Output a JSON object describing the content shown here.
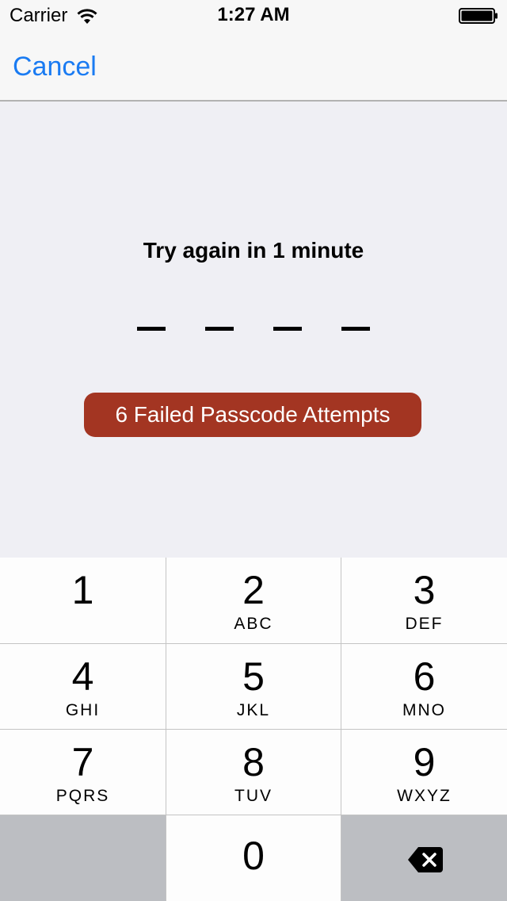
{
  "status_bar": {
    "carrier": "Carrier",
    "time": "1:27 AM",
    "wifi_icon": "wifi-icon",
    "battery_icon": "battery-icon"
  },
  "nav": {
    "cancel_label": "Cancel"
  },
  "lockout": {
    "prompt": "Try again in 1 minute",
    "passcode_length": 4,
    "failed_attempts_label": "6 Failed Passcode Attempts",
    "failed_badge_color": "#a33522"
  },
  "keypad": {
    "keys": [
      {
        "digit": "1",
        "letters": ""
      },
      {
        "digit": "2",
        "letters": "ABC"
      },
      {
        "digit": "3",
        "letters": "DEF"
      },
      {
        "digit": "4",
        "letters": "GHI"
      },
      {
        "digit": "5",
        "letters": "JKL"
      },
      {
        "digit": "6",
        "letters": "MNO"
      },
      {
        "digit": "7",
        "letters": "PQRS"
      },
      {
        "digit": "8",
        "letters": "TUV"
      },
      {
        "digit": "9",
        "letters": "WXYZ"
      },
      {
        "digit": "0",
        "letters": ""
      }
    ],
    "delete_icon": "backspace-icon"
  },
  "colors": {
    "accent": "#1a7bf2",
    "background": "#efeff4",
    "keypad_gray": "#bcbec2"
  }
}
